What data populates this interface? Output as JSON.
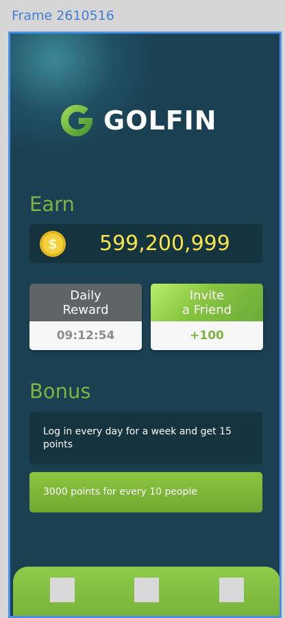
{
  "frame_label": "Frame 2610516",
  "brand": {
    "name": "GOLFIN",
    "icon": "golfin-g-logo-icon"
  },
  "earn": {
    "title": "Earn",
    "balance": "599,200,999",
    "coin_icon": "dollar-coin-icon",
    "coin_symbol": "$"
  },
  "actions": {
    "daily_reward": {
      "label_line1": "Daily",
      "label_line2": "Reward",
      "value": "09:12:54"
    },
    "invite_friend": {
      "label_line1": "Invite",
      "label_line2": "a Friend",
      "value": "+100"
    }
  },
  "bonus": {
    "title": "Bonus",
    "items": [
      "Log in every day for a week and get 15 points",
      "3000 points for every 10 people"
    ]
  },
  "bottom_nav": {
    "items": [
      "nav-placeholder-1",
      "nav-placeholder-2",
      "nav-placeholder-3"
    ]
  },
  "colors": {
    "background": "#1b4052",
    "accent_green": "#7cb342",
    "balance_yellow": "#f9e44a",
    "frame_outline": "#4a90e8"
  }
}
